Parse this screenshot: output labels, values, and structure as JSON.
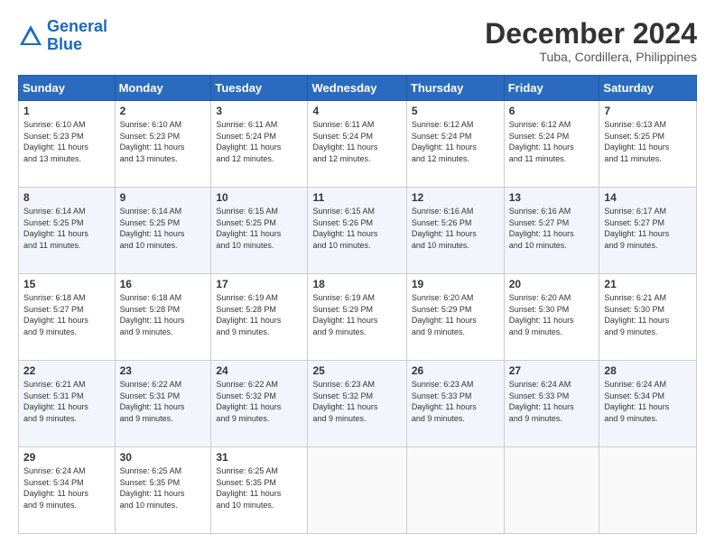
{
  "logo": {
    "line1": "General",
    "line2": "Blue"
  },
  "title": "December 2024",
  "subtitle": "Tuba, Cordillera, Philippines",
  "header_days": [
    "Sunday",
    "Monday",
    "Tuesday",
    "Wednesday",
    "Thursday",
    "Friday",
    "Saturday"
  ],
  "weeks": [
    [
      {
        "day": "1",
        "lines": [
          "Sunrise: 6:10 AM",
          "Sunset: 5:23 PM",
          "Daylight: 11 hours",
          "and 13 minutes."
        ]
      },
      {
        "day": "2",
        "lines": [
          "Sunrise: 6:10 AM",
          "Sunset: 5:23 PM",
          "Daylight: 11 hours",
          "and 13 minutes."
        ]
      },
      {
        "day": "3",
        "lines": [
          "Sunrise: 6:11 AM",
          "Sunset: 5:24 PM",
          "Daylight: 11 hours",
          "and 12 minutes."
        ]
      },
      {
        "day": "4",
        "lines": [
          "Sunrise: 6:11 AM",
          "Sunset: 5:24 PM",
          "Daylight: 11 hours",
          "and 12 minutes."
        ]
      },
      {
        "day": "5",
        "lines": [
          "Sunrise: 6:12 AM",
          "Sunset: 5:24 PM",
          "Daylight: 11 hours",
          "and 12 minutes."
        ]
      },
      {
        "day": "6",
        "lines": [
          "Sunrise: 6:12 AM",
          "Sunset: 5:24 PM",
          "Daylight: 11 hours",
          "and 11 minutes."
        ]
      },
      {
        "day": "7",
        "lines": [
          "Sunrise: 6:13 AM",
          "Sunset: 5:25 PM",
          "Daylight: 11 hours",
          "and 11 minutes."
        ]
      }
    ],
    [
      {
        "day": "8",
        "lines": [
          "Sunrise: 6:14 AM",
          "Sunset: 5:25 PM",
          "Daylight: 11 hours",
          "and 11 minutes."
        ]
      },
      {
        "day": "9",
        "lines": [
          "Sunrise: 6:14 AM",
          "Sunset: 5:25 PM",
          "Daylight: 11 hours",
          "and 10 minutes."
        ]
      },
      {
        "day": "10",
        "lines": [
          "Sunrise: 6:15 AM",
          "Sunset: 5:25 PM",
          "Daylight: 11 hours",
          "and 10 minutes."
        ]
      },
      {
        "day": "11",
        "lines": [
          "Sunrise: 6:15 AM",
          "Sunset: 5:26 PM",
          "Daylight: 11 hours",
          "and 10 minutes."
        ]
      },
      {
        "day": "12",
        "lines": [
          "Sunrise: 6:16 AM",
          "Sunset: 5:26 PM",
          "Daylight: 11 hours",
          "and 10 minutes."
        ]
      },
      {
        "day": "13",
        "lines": [
          "Sunrise: 6:16 AM",
          "Sunset: 5:27 PM",
          "Daylight: 11 hours",
          "and 10 minutes."
        ]
      },
      {
        "day": "14",
        "lines": [
          "Sunrise: 6:17 AM",
          "Sunset: 5:27 PM",
          "Daylight: 11 hours",
          "and 9 minutes."
        ]
      }
    ],
    [
      {
        "day": "15",
        "lines": [
          "Sunrise: 6:18 AM",
          "Sunset: 5:27 PM",
          "Daylight: 11 hours",
          "and 9 minutes."
        ]
      },
      {
        "day": "16",
        "lines": [
          "Sunrise: 6:18 AM",
          "Sunset: 5:28 PM",
          "Daylight: 11 hours",
          "and 9 minutes."
        ]
      },
      {
        "day": "17",
        "lines": [
          "Sunrise: 6:19 AM",
          "Sunset: 5:28 PM",
          "Daylight: 11 hours",
          "and 9 minutes."
        ]
      },
      {
        "day": "18",
        "lines": [
          "Sunrise: 6:19 AM",
          "Sunset: 5:29 PM",
          "Daylight: 11 hours",
          "and 9 minutes."
        ]
      },
      {
        "day": "19",
        "lines": [
          "Sunrise: 6:20 AM",
          "Sunset: 5:29 PM",
          "Daylight: 11 hours",
          "and 9 minutes."
        ]
      },
      {
        "day": "20",
        "lines": [
          "Sunrise: 6:20 AM",
          "Sunset: 5:30 PM",
          "Daylight: 11 hours",
          "and 9 minutes."
        ]
      },
      {
        "day": "21",
        "lines": [
          "Sunrise: 6:21 AM",
          "Sunset: 5:30 PM",
          "Daylight: 11 hours",
          "and 9 minutes."
        ]
      }
    ],
    [
      {
        "day": "22",
        "lines": [
          "Sunrise: 6:21 AM",
          "Sunset: 5:31 PM",
          "Daylight: 11 hours",
          "and 9 minutes."
        ]
      },
      {
        "day": "23",
        "lines": [
          "Sunrise: 6:22 AM",
          "Sunset: 5:31 PM",
          "Daylight: 11 hours",
          "and 9 minutes."
        ]
      },
      {
        "day": "24",
        "lines": [
          "Sunrise: 6:22 AM",
          "Sunset: 5:32 PM",
          "Daylight: 11 hours",
          "and 9 minutes."
        ]
      },
      {
        "day": "25",
        "lines": [
          "Sunrise: 6:23 AM",
          "Sunset: 5:32 PM",
          "Daylight: 11 hours",
          "and 9 minutes."
        ]
      },
      {
        "day": "26",
        "lines": [
          "Sunrise: 6:23 AM",
          "Sunset: 5:33 PM",
          "Daylight: 11 hours",
          "and 9 minutes."
        ]
      },
      {
        "day": "27",
        "lines": [
          "Sunrise: 6:24 AM",
          "Sunset: 5:33 PM",
          "Daylight: 11 hours",
          "and 9 minutes."
        ]
      },
      {
        "day": "28",
        "lines": [
          "Sunrise: 6:24 AM",
          "Sunset: 5:34 PM",
          "Daylight: 11 hours",
          "and 9 minutes."
        ]
      }
    ],
    [
      {
        "day": "29",
        "lines": [
          "Sunrise: 6:24 AM",
          "Sunset: 5:34 PM",
          "Daylight: 11 hours",
          "and 9 minutes."
        ]
      },
      {
        "day": "30",
        "lines": [
          "Sunrise: 6:25 AM",
          "Sunset: 5:35 PM",
          "Daylight: 11 hours",
          "and 10 minutes."
        ]
      },
      {
        "day": "31",
        "lines": [
          "Sunrise: 6:25 AM",
          "Sunset: 5:35 PM",
          "Daylight: 11 hours",
          "and 10 minutes."
        ]
      },
      null,
      null,
      null,
      null
    ]
  ]
}
